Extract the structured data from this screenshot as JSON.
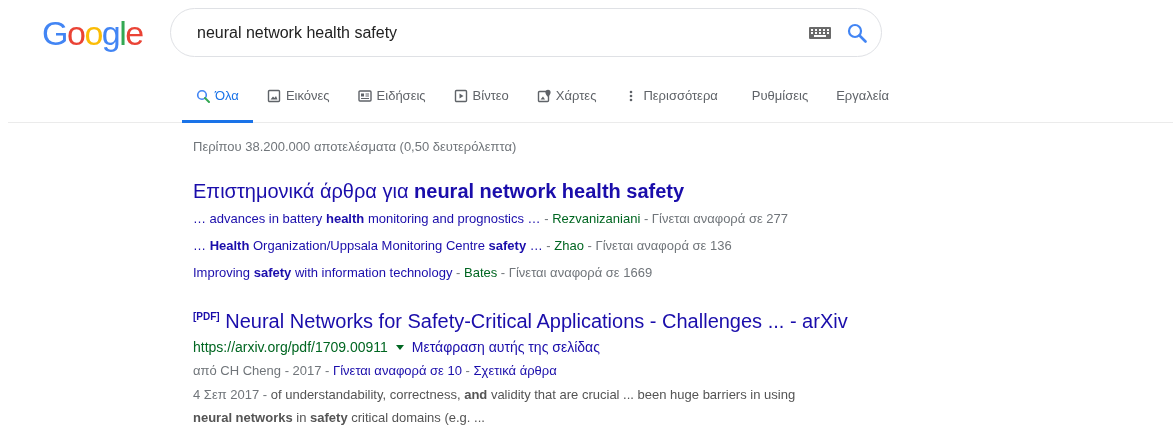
{
  "logo": "Google",
  "search": {
    "value": "neural network health safety"
  },
  "tabs": [
    {
      "label": "Όλα",
      "kind": "search",
      "selected": true
    },
    {
      "label": "Εικόνες",
      "kind": "image",
      "selected": false
    },
    {
      "label": "Ειδήσεις",
      "kind": "news",
      "selected": false
    },
    {
      "label": "Βίντεο",
      "kind": "video",
      "selected": false
    },
    {
      "label": "Χάρτες",
      "kind": "map",
      "selected": false
    },
    {
      "label": "Περισσότερα",
      "kind": "more",
      "selected": false
    },
    {
      "label": "Ρυθμίσεις",
      "kind": "setting",
      "selected": false
    },
    {
      "label": "Εργαλεία",
      "kind": "setting",
      "selected": false
    }
  ],
  "result_stats": "Περίπου 38.200.000 αποτελέσματα (0,50 δευτερόλεπτα)",
  "scholar": {
    "heading": "Επιστημονικά άρθρα για **neural network health safety**",
    "lines": [
      [
        {
          "kind": "link",
          "text": "… advances in battery **health** monitoring and prognostics …"
        },
        {
          "kind": "plain",
          "text": " - "
        },
        {
          "kind": "author",
          "text": "Rezvanizaniani"
        },
        {
          "kind": "plain",
          "text": " - Γίνεται αναφορά σε 277"
        }
      ],
      [
        {
          "kind": "link",
          "text": "… **Health** Organization/Uppsala Monitoring Centre **safety** …"
        },
        {
          "kind": "plain",
          "text": " - "
        },
        {
          "kind": "author",
          "text": "Zhao"
        },
        {
          "kind": "plain",
          "text": " - Γίνεται αναφορά σε 136"
        }
      ],
      [
        {
          "kind": "link",
          "text": "Improving **safety** with information technology"
        },
        {
          "kind": "plain",
          "text": " - "
        },
        {
          "kind": "author",
          "text": "Bates"
        },
        {
          "kind": "plain",
          "text": " - Γίνεται αναφορά σε 1669"
        }
      ]
    ]
  },
  "result": {
    "tag": "[PDF]",
    "title": "Neural Networks for Safety-Critical Applications - Challenges ... - arXiv",
    "url": "https://arxiv.org/pdf/1709.00911",
    "translate": "Μετάφραση αυτής της σελίδας",
    "meta": [
      {
        "kind": "plain",
        "text": "από CH Cheng - 2017 - "
      },
      {
        "kind": "link",
        "text": "Γίνεται αναφορά σε 10"
      },
      {
        "kind": "plain",
        "text": " - "
      },
      {
        "kind": "link",
        "text": "Σχετικά άρθρα"
      }
    ],
    "date": "4 Σεπ 2017 - ",
    "snippet": "of understandability, correctness, **and** validity that are crucial ... been huge barriers in using **neural networks** in **safety** critical domains (e.g. ..."
  }
}
